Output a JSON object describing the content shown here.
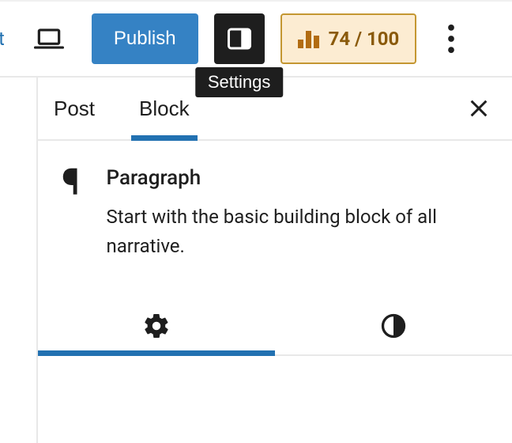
{
  "topbar": {
    "edge_fragment": "t",
    "publish_label": "Publish",
    "settings_tooltip": "Settings",
    "seo_score": "74 / 100"
  },
  "panel": {
    "tabs": [
      {
        "label": "Post",
        "active": false
      },
      {
        "label": "Block",
        "active": true
      }
    ]
  },
  "block": {
    "icon": "¶",
    "title": "Paragraph",
    "description": "Start with the basic building block of all narrative."
  },
  "subtabs": [
    {
      "name": "settings",
      "active": true
    },
    {
      "name": "styles",
      "active": false
    }
  ]
}
